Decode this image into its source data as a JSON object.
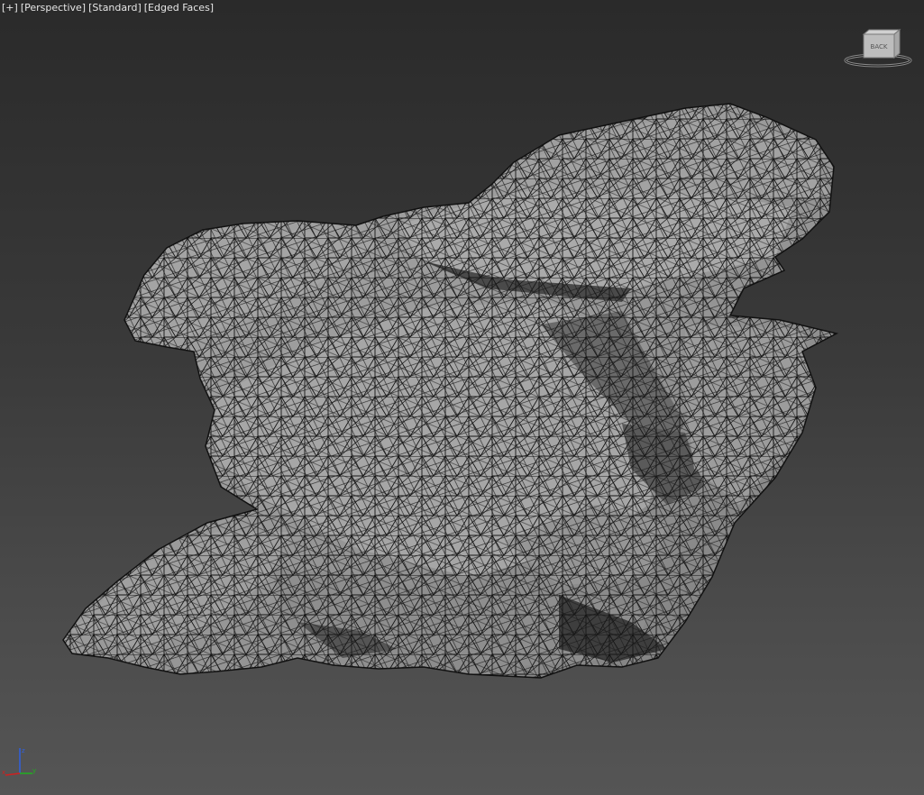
{
  "viewport": {
    "labels": [
      "[+]",
      "[Perspective]",
      "[Standard]",
      "[Edged Faces]"
    ],
    "viewcube_face": "BACK"
  },
  "colors": {
    "background_top": "#2a2a2a",
    "background_bottom": "#555555",
    "mesh_fill": "#9a9a9a",
    "mesh_edge": "#111111",
    "axis_x": "#d02020",
    "axis_y": "#20b020",
    "axis_z": "#3060e0"
  },
  "icons": {
    "viewcube": "viewcube-icon",
    "axis_tripod": "axis-tripod-icon"
  }
}
